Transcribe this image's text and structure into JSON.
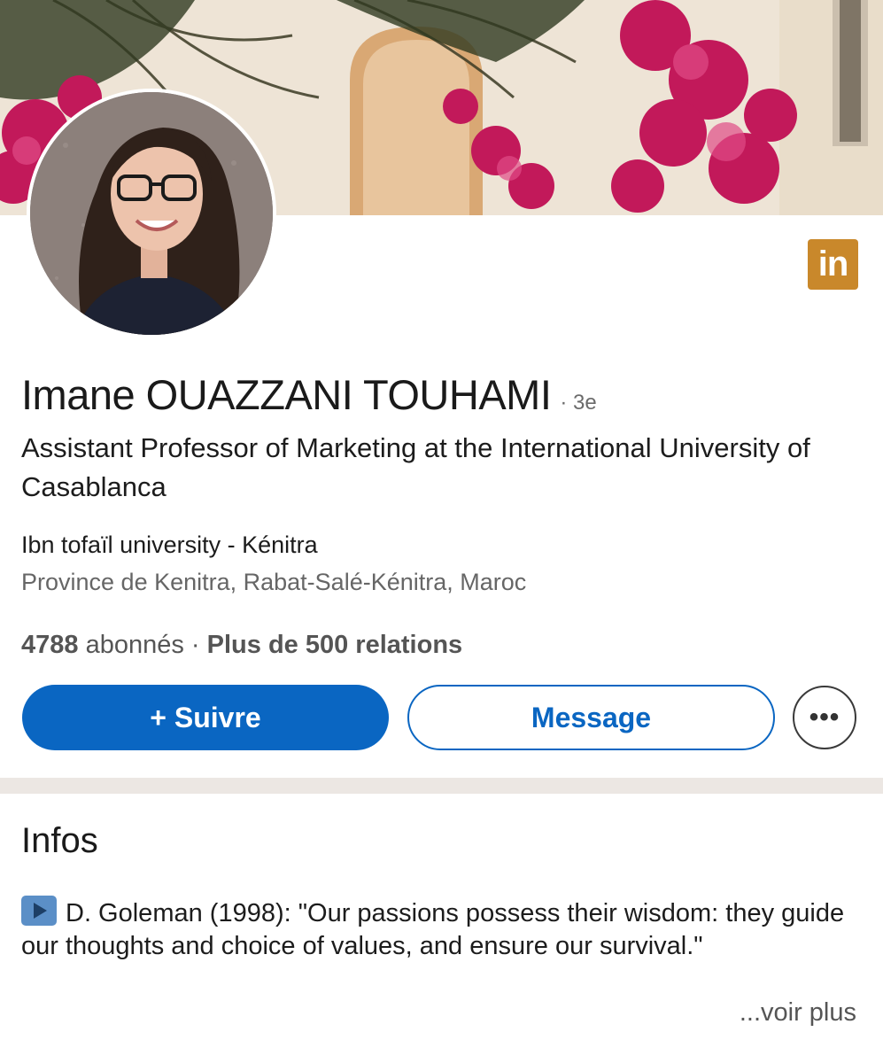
{
  "profile": {
    "name": "Imane OUAZZANI TOUHAMI",
    "degree": "· 3e",
    "headline": "Assistant Professor of Marketing at the International University of Casablanca",
    "school": "Ibn tofaïl university - Kénitra",
    "location": "Province de Kenitra, Rabat-Salé-Kénitra, Maroc",
    "followers_count": "4788",
    "followers_label": "abonnés",
    "separator": "·",
    "connections": "Plus de 500 relations"
  },
  "brand": {
    "logo_text": "in",
    "logo_color": "#c9882b"
  },
  "actions": {
    "follow_label": "+ Suivre",
    "message_label": "Message",
    "more_label": "•••",
    "primary_color": "#0a66c2"
  },
  "about": {
    "title": "Infos",
    "icon": "play-button-icon",
    "text": "D. Goleman (1998): \"Our passions possess their wisdom: they guide our thoughts and choice of values, and ensure our survival.\"",
    "see_more": "...voir plus"
  }
}
